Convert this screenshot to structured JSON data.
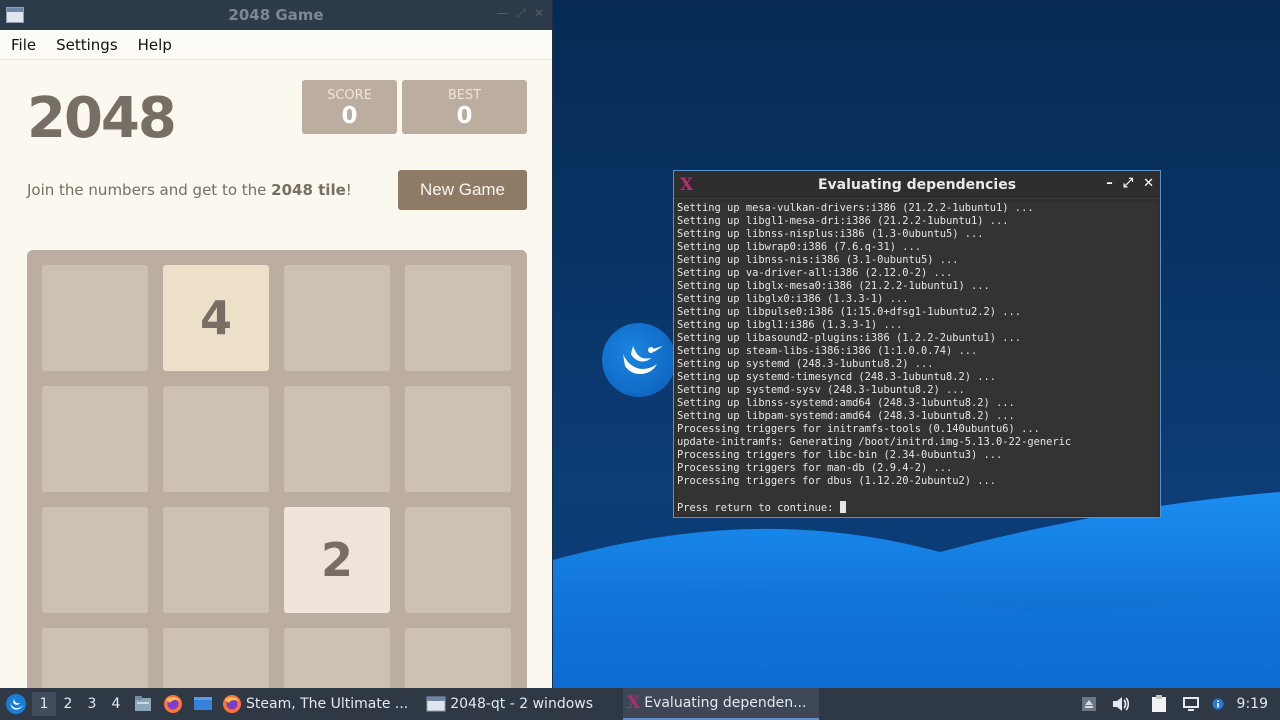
{
  "game_window": {
    "title": "2048 Game",
    "menu": [
      "File",
      "Settings",
      "Help"
    ],
    "heading": "2048",
    "score_label": "SCORE",
    "score_value": "0",
    "best_label": "BEST",
    "best_value": "0",
    "intro_prefix": "Join the numbers and get to the ",
    "intro_bold": "2048 tile",
    "intro_suffix": "!",
    "new_game_label": "New Game",
    "board": [
      [
        "",
        "4",
        "",
        ""
      ],
      [
        "",
        "",
        "",
        ""
      ],
      [
        "",
        "",
        "2",
        ""
      ],
      [
        "",
        "",
        "",
        ""
      ]
    ]
  },
  "terminal_window": {
    "title": "Evaluating dependencies",
    "icon": "X",
    "lines": [
      "Setting up mesa-vulkan-drivers:i386 (21.2.2-1ubuntu1) ...",
      "Setting up libgl1-mesa-dri:i386 (21.2.2-1ubuntu1) ...",
      "Setting up libnss-nisplus:i386 (1.3-0ubuntu5) ...",
      "Setting up libwrap0:i386 (7.6.q-31) ...",
      "Setting up libnss-nis:i386 (3.1-0ubuntu5) ...",
      "Setting up va-driver-all:i386 (2.12.0-2) ...",
      "Setting up libglx-mesa0:i386 (21.2.2-1ubuntu1) ...",
      "Setting up libglx0:i386 (1.3.3-1) ...",
      "Setting up libpulse0:i386 (1:15.0+dfsg1-1ubuntu2.2) ...",
      "Setting up libgl1:i386 (1.3.3-1) ...",
      "Setting up libasound2-plugins:i386 (1.2.2-2ubuntu1) ...",
      "Setting up steam-libs-i386:i386 (1:1.0.0.74) ...",
      "Setting up systemd (248.3-1ubuntu8.2) ...",
      "Setting up systemd-timesyncd (248.3-1ubuntu8.2) ...",
      "Setting up systemd-sysv (248.3-1ubuntu8.2) ...",
      "Setting up libnss-systemd:amd64 (248.3-1ubuntu8.2) ...",
      "Setting up libpam-systemd:amd64 (248.3-1ubuntu8.2) ...",
      "Processing triggers for initramfs-tools (0.140ubuntu6) ...",
      "update-initramfs: Generating /boot/initrd.img-5.13.0-22-generic",
      "Processing triggers for libc-bin (2.34-0ubuntu3) ...",
      "Processing triggers for man-db (2.9.4-2) ...",
      "Processing triggers for dbus (1.12.20-2ubuntu2) ...",
      ""
    ],
    "prompt": "Press return to continue: "
  },
  "taskbar": {
    "workspaces": [
      "1",
      "2",
      "3",
      "4"
    ],
    "active_workspace": "1",
    "tasks": [
      {
        "label": "Steam, The Ultimate ...",
        "icon": "firefox-icon"
      },
      {
        "label": "2048-qt - 2 windows",
        "icon": "window-icon"
      },
      {
        "label": "Evaluating dependen...",
        "icon": "xterm-icon"
      }
    ],
    "clock": "9:19"
  }
}
